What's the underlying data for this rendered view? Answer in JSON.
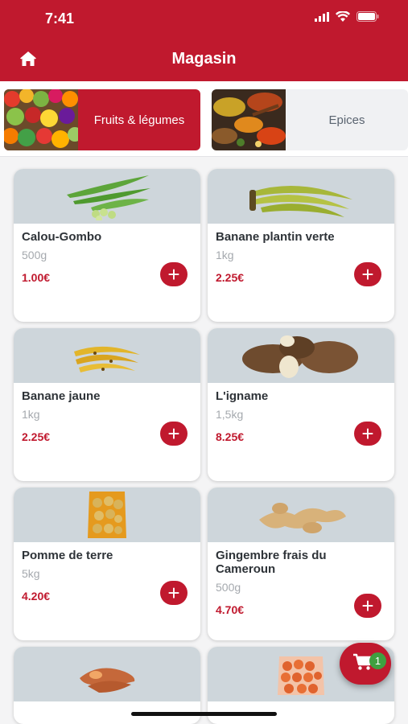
{
  "status_bar": {
    "time": "7:41"
  },
  "header": {
    "title": "Magasin",
    "home_icon": "home-icon"
  },
  "categories": [
    {
      "label": "Fruits & légumes",
      "active": true
    },
    {
      "label": "Epices",
      "active": false
    }
  ],
  "products": [
    {
      "name": "Calou-Gombo",
      "weight": "500g",
      "price": "1.00€"
    },
    {
      "name": "Banane plantin verte",
      "weight": "1kg",
      "price": "2.25€"
    },
    {
      "name": "Banane jaune",
      "weight": "1kg",
      "price": "2.25€"
    },
    {
      "name": "L'igname",
      "weight": "1,5kg",
      "price": "8.25€"
    },
    {
      "name": "Pomme de terre",
      "weight": "5kg",
      "price": "4.20€"
    },
    {
      "name": "Gingembre frais du Cameroun",
      "weight": "500g",
      "price": "4.70€"
    }
  ],
  "cart": {
    "count": "1",
    "icon": "cart-icon"
  },
  "colors": {
    "primary": "#c0192e",
    "badge": "#3fa040",
    "card_image_bg": "#ced6db"
  }
}
